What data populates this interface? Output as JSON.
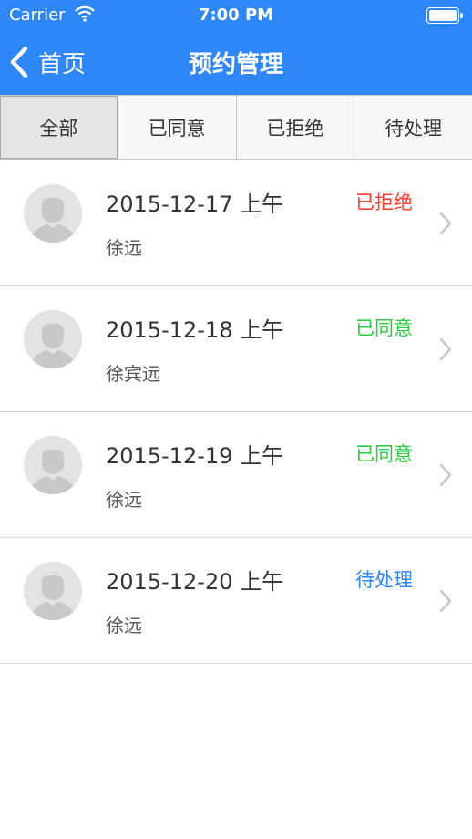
{
  "status_bar": {
    "carrier": "Carrier",
    "time": "7:00 PM"
  },
  "nav": {
    "back_label": "首页",
    "title": "预约管理"
  },
  "tabs": [
    {
      "label": "全部",
      "active": true
    },
    {
      "label": "已同意",
      "active": false
    },
    {
      "label": "已拒绝",
      "active": false
    },
    {
      "label": "待处理",
      "active": false
    }
  ],
  "colors": {
    "nav_blue": "#2f86f6",
    "rejected": "#ff3b30",
    "approved": "#2ecc40",
    "pending": "#2f86f6"
  },
  "appointments": [
    {
      "date": "2015-12-17 上午",
      "name": "徐远",
      "status": "已拒绝",
      "status_color": "#ff3b30"
    },
    {
      "date": "2015-12-18 上午",
      "name": "徐宾远",
      "status": "已同意",
      "status_color": "#2ecc40"
    },
    {
      "date": "2015-12-19 上午",
      "name": "徐远",
      "status": "已同意",
      "status_color": "#2ecc40"
    },
    {
      "date": "2015-12-20 上午",
      "name": "徐远",
      "status": "待处理",
      "status_color": "#2f86f6"
    }
  ]
}
